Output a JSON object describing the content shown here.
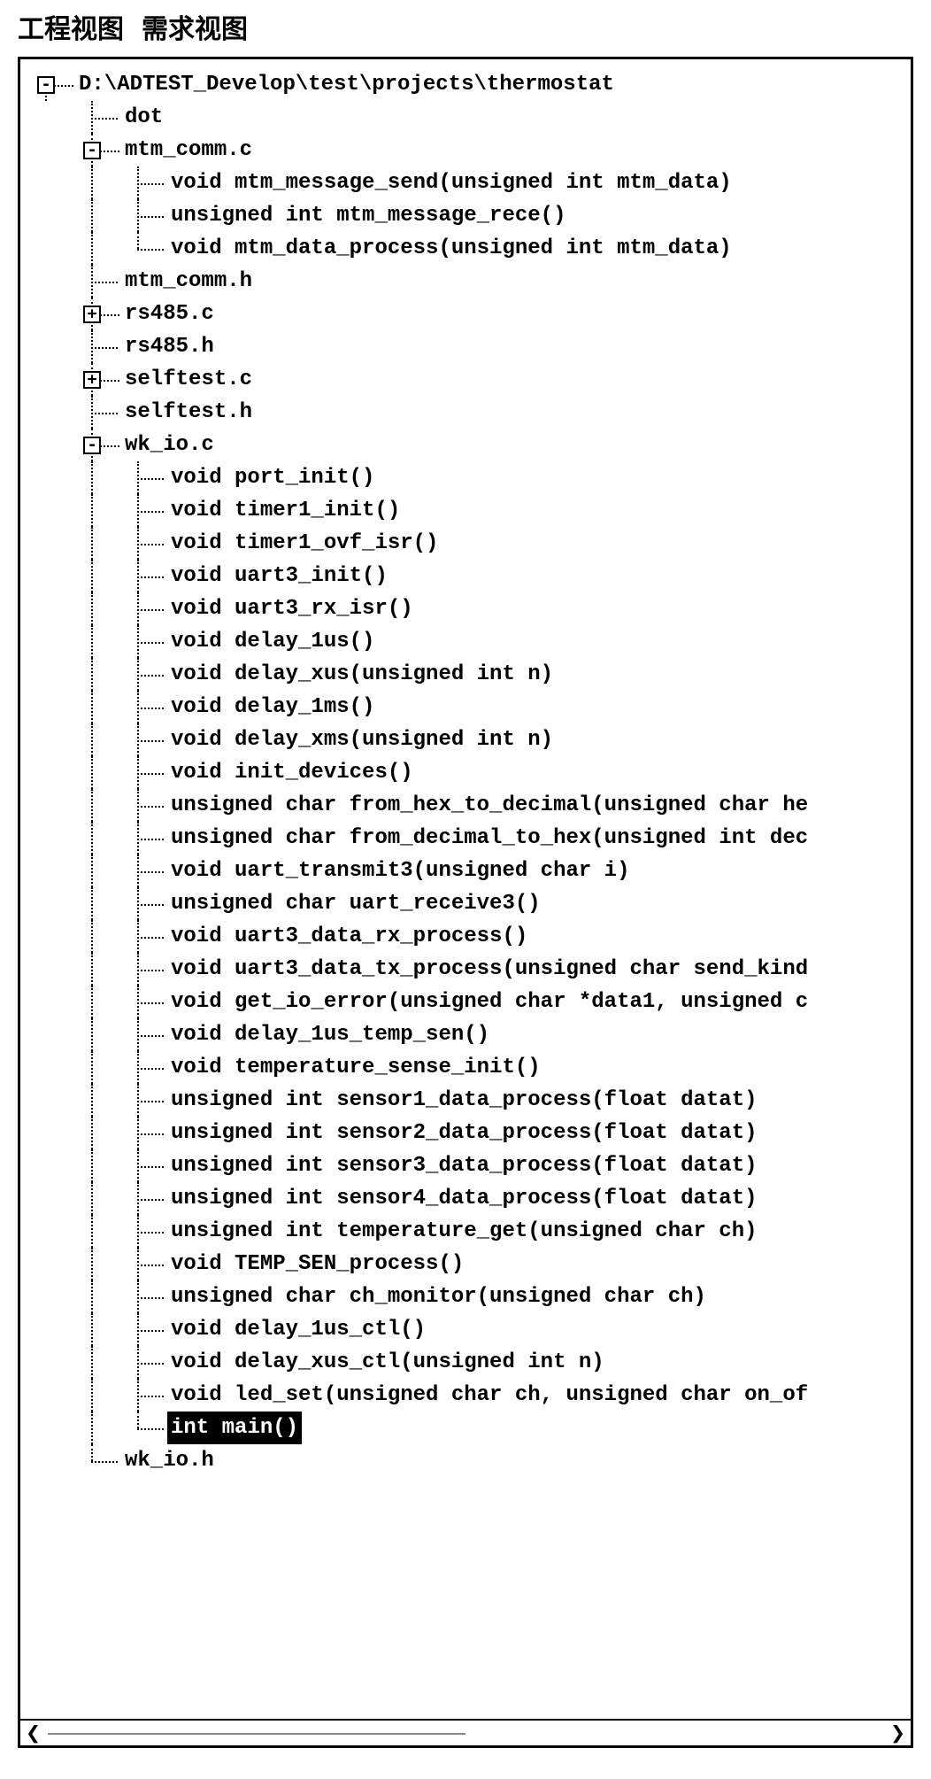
{
  "tabs": {
    "project_view": "工程视图",
    "requirement_view": "需求视图"
  },
  "tree": {
    "root": {
      "label": "D:\\ADTEST_Develop\\test\\projects\\thermostat",
      "expanded": true,
      "children": [
        {
          "label": "dot",
          "type": "leaf"
        },
        {
          "label": "mtm_comm.c",
          "type": "branch",
          "expanded": true,
          "children": [
            {
              "label": "void mtm_message_send(unsigned int mtm_data)"
            },
            {
              "label": "unsigned int mtm_message_rece()"
            },
            {
              "label": "void mtm_data_process(unsigned int mtm_data)"
            }
          ]
        },
        {
          "label": "mtm_comm.h",
          "type": "leaf"
        },
        {
          "label": "rs485.c",
          "type": "branch",
          "expanded": false
        },
        {
          "label": "rs485.h",
          "type": "leaf"
        },
        {
          "label": "selftest.c",
          "type": "branch",
          "expanded": false
        },
        {
          "label": "selftest.h",
          "type": "leaf"
        },
        {
          "label": "wk_io.c",
          "type": "branch",
          "expanded": true,
          "children": [
            {
              "label": "void port_init()"
            },
            {
              "label": "void timer1_init()"
            },
            {
              "label": "void timer1_ovf_isr()"
            },
            {
              "label": "void uart3_init()"
            },
            {
              "label": "void uart3_rx_isr()"
            },
            {
              "label": "void delay_1us()"
            },
            {
              "label": "void delay_xus(unsigned int n)"
            },
            {
              "label": "void delay_1ms()"
            },
            {
              "label": "void delay_xms(unsigned int n)"
            },
            {
              "label": "void init_devices()"
            },
            {
              "label": "unsigned char from_hex_to_decimal(unsigned char he"
            },
            {
              "label": "unsigned char from_decimal_to_hex(unsigned int dec"
            },
            {
              "label": "void uart_transmit3(unsigned char i)"
            },
            {
              "label": "unsigned char uart_receive3()"
            },
            {
              "label": "void uart3_data_rx_process()"
            },
            {
              "label": "void uart3_data_tx_process(unsigned char send_kind"
            },
            {
              "label": "void get_io_error(unsigned char *data1, unsigned c"
            },
            {
              "label": "void delay_1us_temp_sen()"
            },
            {
              "label": "void temperature_sense_init()"
            },
            {
              "label": "unsigned int sensor1_data_process(float datat)"
            },
            {
              "label": "unsigned int sensor2_data_process(float datat)"
            },
            {
              "label": "unsigned int sensor3_data_process(float datat)"
            },
            {
              "label": "unsigned int sensor4_data_process(float datat)"
            },
            {
              "label": "unsigned int temperature_get(unsigned char ch)"
            },
            {
              "label": "void TEMP_SEN_process()"
            },
            {
              "label": "unsigned char ch_monitor(unsigned char ch)"
            },
            {
              "label": "void delay_1us_ctl()"
            },
            {
              "label": "void delay_xus_ctl(unsigned int n)"
            },
            {
              "label": "void led_set(unsigned char ch, unsigned char on_of"
            },
            {
              "label": "int main()",
              "selected": true
            }
          ]
        },
        {
          "label": "wk_io.h",
          "type": "leaf"
        }
      ]
    }
  },
  "toggle_symbols": {
    "collapsed": "+",
    "expanded": "-"
  }
}
